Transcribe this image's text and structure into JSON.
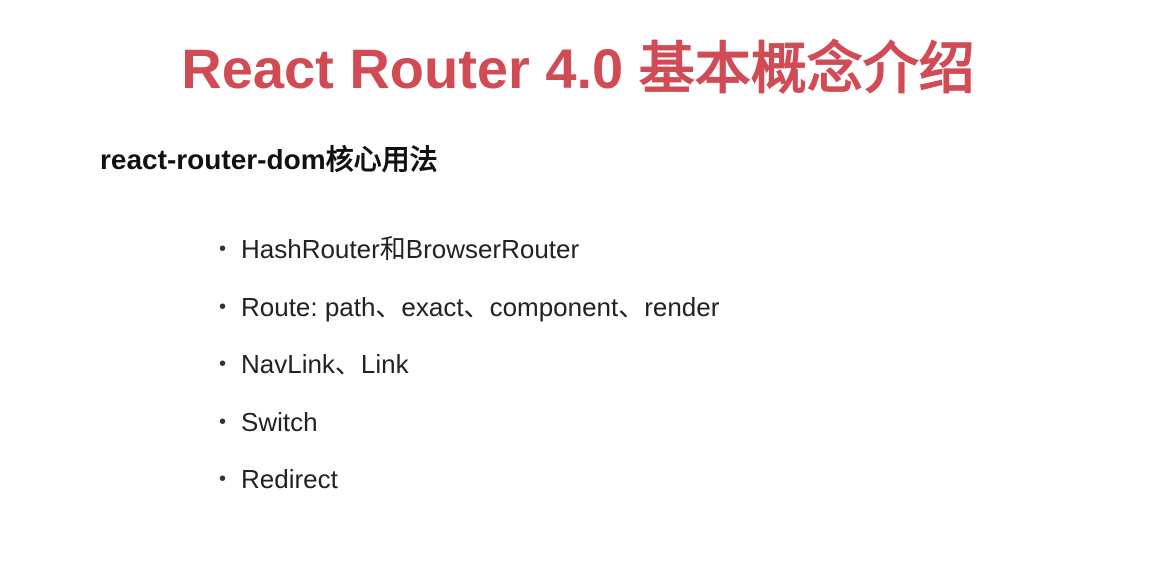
{
  "slide": {
    "title": "React Router 4.0 基本概念介绍",
    "title_color": "#d14b54",
    "subtitle": "react-router-dom核心用法",
    "bullet_symbol": "•",
    "items": [
      "HashRouter和BrowserRouter",
      "Route: path、exact、component、render",
      "NavLink、Link",
      "Switch",
      "Redirect"
    ]
  }
}
